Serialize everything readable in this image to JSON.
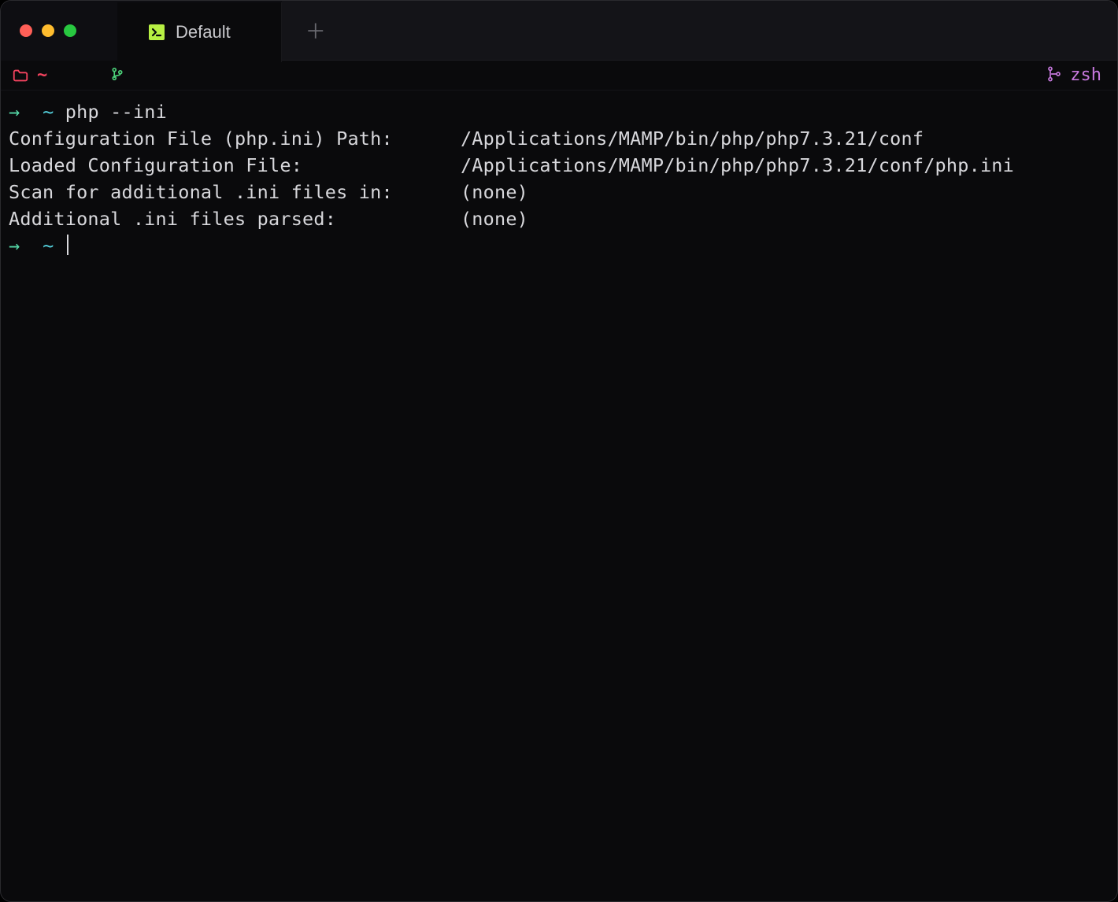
{
  "window": {
    "tab_label": "Default",
    "new_tab_icon": "plus-icon"
  },
  "status": {
    "cwd_symbol": "~",
    "shell": "zsh"
  },
  "terminal": {
    "prompt_arrow": "→",
    "prompt_tilde": "~",
    "lines": [
      {
        "type": "prompt",
        "command": "php --ini"
      },
      {
        "type": "output",
        "label": "Configuration File (php.ini) Path:",
        "value": "/Applications/MAMP/bin/php/php7.3.21/conf"
      },
      {
        "type": "output",
        "label": "Loaded Configuration File:",
        "value": "/Applications/MAMP/bin/php/php7.3.21/conf/php.ini"
      },
      {
        "type": "output",
        "label": "Scan for additional .ini files in:",
        "value": "(none)"
      },
      {
        "type": "output",
        "label": "Additional .ini files parsed:",
        "value": "(none)"
      },
      {
        "type": "prompt_empty"
      }
    ],
    "label_col_width": 40
  }
}
